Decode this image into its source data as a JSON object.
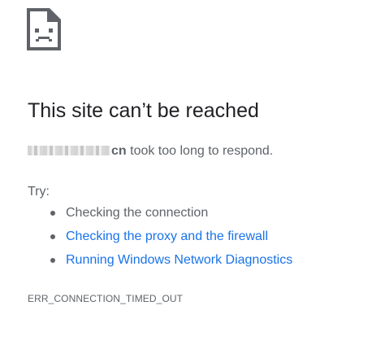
{
  "icon": "sad-page-icon",
  "title": "This site can’t be reached",
  "message": {
    "domain_visible_suffix": "cn",
    "text": " took too long to respond."
  },
  "try_label": "Try:",
  "suggestions": [
    {
      "label": "Checking the connection",
      "is_link": false
    },
    {
      "label": "Checking the proxy and the firewall",
      "is_link": true
    },
    {
      "label": "Running Windows Network Diagnostics",
      "is_link": true
    }
  ],
  "error_code": "ERR_CONNECTION_TIMED_OUT",
  "colors": {
    "text": "#5f6368",
    "title": "#202124",
    "link": "#1a73e8",
    "icon": "#5f6368"
  }
}
